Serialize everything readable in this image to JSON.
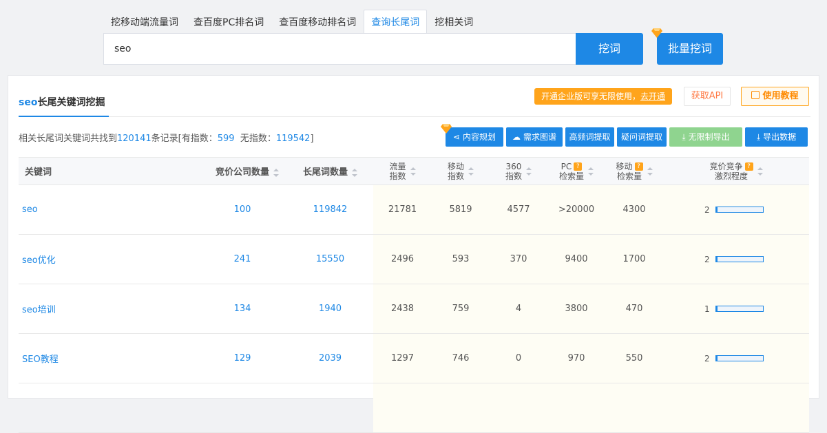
{
  "tabs": [
    {
      "label": "挖移动端流量词"
    },
    {
      "label": "查百度PC排名词"
    },
    {
      "label": "查百度移动排名词"
    },
    {
      "label": "查询长尾词",
      "active": true
    },
    {
      "label": "挖相关词"
    }
  ],
  "search": {
    "value": "seo",
    "dig_label": "挖词",
    "batch_label": "批量挖词"
  },
  "panel": {
    "title_keyword": "seo",
    "title_suffix": "长尾关键词挖掘",
    "promo_text": "开通企业版可享无限使用，",
    "promo_link": "去开通",
    "api_label": "获取API",
    "tutorial_label": "使用教程"
  },
  "summary": {
    "prefix": "相关长尾词关键词共找到",
    "total": "120141",
    "mid": "条记录[有指数：",
    "with_index": "599",
    "mid2": "  无指数：",
    "without_index": "119542",
    "suffix": "]"
  },
  "toolbar": {
    "content_plan": "内容规划",
    "demand_map": "需求图谱",
    "high_freq": "高频词提取",
    "question": "疑问词提取",
    "unlimited_export": "无限制导出",
    "export": "导出数据"
  },
  "table": {
    "headers": {
      "keyword": "关键词",
      "bidders": "竞价公司数量",
      "longtail": "长尾词数量",
      "traffic_1": "流量",
      "traffic_2": "指数",
      "mobile_1": "移动",
      "mobile_2": "指数",
      "i360_1": "360",
      "i360_2": "指数",
      "pc_1": "PC",
      "pc_2": "检索量",
      "mob_1": "移动",
      "mob_2": "检索量",
      "comp_1": "竞价竞争",
      "comp_2": "激烈程度"
    },
    "rows": [
      {
        "keyword": "seo",
        "bidders": "100",
        "longtail": "119842",
        "traffic": "21781",
        "mobile": "5819",
        "i360": "4577",
        "pc": ">20000",
        "mob": "4300",
        "level": "2",
        "level_fraction": 0.04
      },
      {
        "keyword": "seo优化",
        "bidders": "241",
        "longtail": "15550",
        "traffic": "2496",
        "mobile": "593",
        "i360": "370",
        "pc": "9400",
        "mob": "1700",
        "level": "2",
        "level_fraction": 0.04
      },
      {
        "keyword": "seo培训",
        "bidders": "134",
        "longtail": "1940",
        "traffic": "2438",
        "mobile": "759",
        "i360": "4",
        "pc": "3800",
        "mob": "470",
        "level": "1",
        "level_fraction": 0.03
      },
      {
        "keyword": "SEO教程",
        "bidders": "129",
        "longtail": "2039",
        "traffic": "1297",
        "mobile": "746",
        "i360": "0",
        "pc": "970",
        "mob": "550",
        "level": "2",
        "level_fraction": 0.04
      },
      {
        "keyword": "",
        "bidders": "",
        "longtail": "",
        "traffic": "",
        "mobile": "",
        "i360": "",
        "pc": "",
        "mob": "",
        "level": "",
        "level_fraction": 0
      }
    ]
  },
  "colors": {
    "accent": "#1e88e5",
    "orange": "#ffa41b",
    "green": "#8fd48f"
  }
}
